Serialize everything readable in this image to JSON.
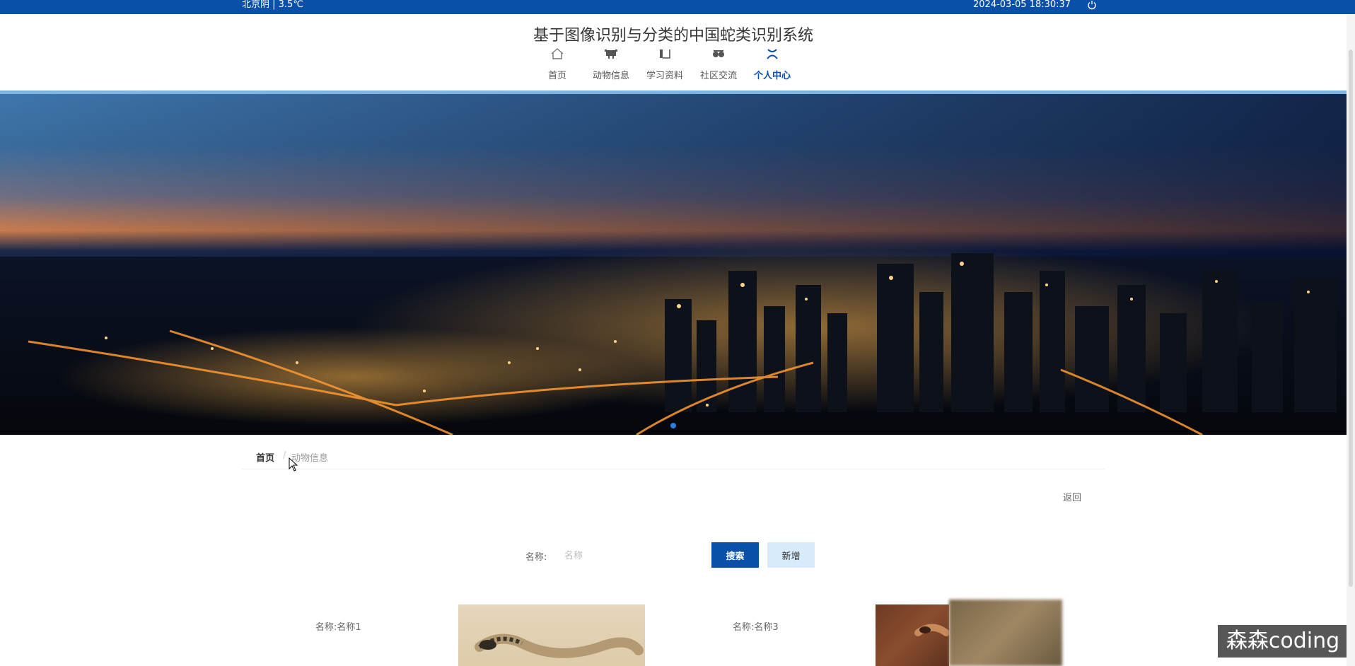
{
  "topbar": {
    "weather": "北京阴 | 3.5℃",
    "datetime": "2024-03-05  18:30:37",
    "power_icon": "power-icon"
  },
  "header": {
    "title": "基于图像识别与分类的中国蛇类识别系统"
  },
  "nav": {
    "items": [
      {
        "label": "首页",
        "icon": "home-icon"
      },
      {
        "label": "动物信息",
        "icon": "animal-icon"
      },
      {
        "label": "学习资料",
        "icon": "book-icon"
      },
      {
        "label": "社区交流",
        "icon": "chat-icon"
      },
      {
        "label": "个人中心",
        "icon": "user-icon"
      }
    ],
    "active_index": 4
  },
  "breadcrumb": {
    "home": "首页",
    "separator": "/",
    "current": "动物信息"
  },
  "actions": {
    "back_label": "返回"
  },
  "search": {
    "label": "名称:",
    "placeholder": "名称",
    "search_button": "搜索",
    "add_button": "新增"
  },
  "items": [
    {
      "name": "名称:名称1"
    },
    {
      "name": "名称:名称3"
    }
  ],
  "watermark": "森森coding",
  "colors": {
    "primary": "#0a4fa8",
    "accent_light": "#d8ebfa",
    "header_line": "#7fb5e3"
  }
}
